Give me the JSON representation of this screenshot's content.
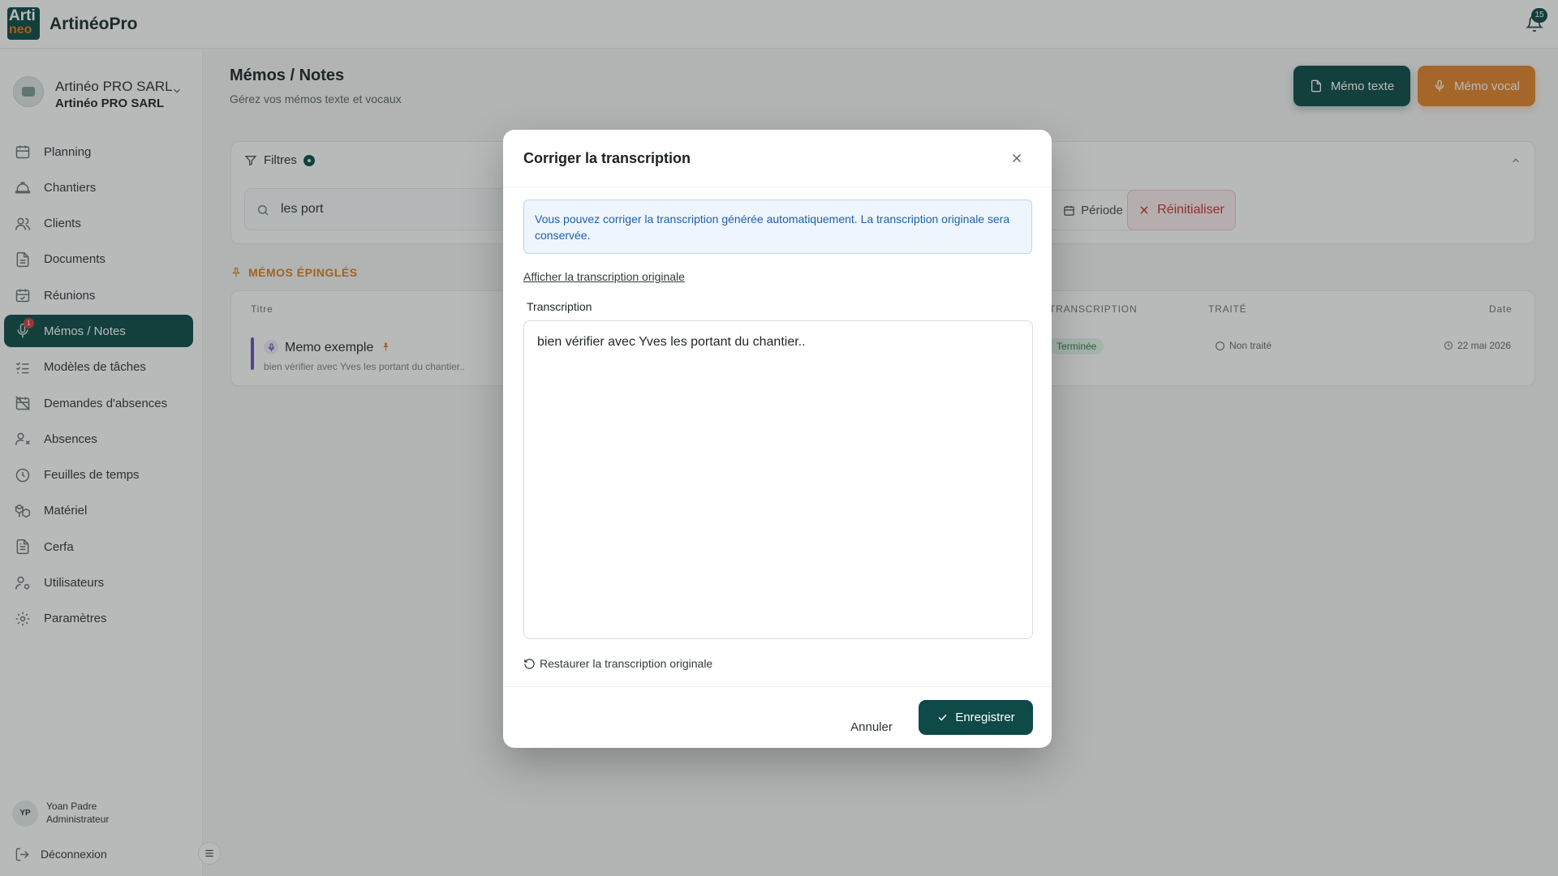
{
  "app": {
    "name": "ArtinéoPro",
    "logo_line1": "Arti",
    "logo_line2": "neo",
    "notification_count": "15"
  },
  "company": {
    "name": "Artinéo PRO SARL",
    "subname": "Artinéo PRO SARL"
  },
  "nav": [
    {
      "label": "Planning",
      "icon": "calendar-icon"
    },
    {
      "label": "Chantiers",
      "icon": "hardhat-icon"
    },
    {
      "label": "Clients",
      "icon": "users-icon"
    },
    {
      "label": "Documents",
      "icon": "file-icon"
    },
    {
      "label": "Réunions",
      "icon": "calendar-check-icon"
    },
    {
      "label": "Mémos / Notes",
      "icon": "mic-icon",
      "active": true,
      "badge": "1"
    },
    {
      "label": "Modèles de tâches",
      "icon": "list-checks-icon"
    },
    {
      "label": "Demandes d'absences",
      "icon": "calendar-off-icon"
    },
    {
      "label": "Absences",
      "icon": "user-x-icon"
    },
    {
      "label": "Feuilles de temps",
      "icon": "clock-icon"
    },
    {
      "label": "Matériel",
      "icon": "boxes-icon"
    },
    {
      "label": "Cerfa",
      "icon": "file-text-icon"
    },
    {
      "label": "Utilisateurs",
      "icon": "user-cog-icon"
    },
    {
      "label": "Paramètres",
      "icon": "gear-icon"
    }
  ],
  "user": {
    "initials": "YP",
    "name": "Yoan Padre",
    "role": "Administrateur"
  },
  "logout_label": "Déconnexion",
  "page": {
    "title": "Mémos / Notes",
    "subtitle": "Gérez vos mémos texte et vocaux"
  },
  "actions": {
    "text_memo": "Mémo texte",
    "voice_memo": "Mémo vocal"
  },
  "filters": {
    "label": "Filtres",
    "search_value": "les port",
    "period": "Période",
    "reset": "Réinitialiser"
  },
  "pinned": {
    "label": "MÉMOS ÉPINGLÉS"
  },
  "table": {
    "columns": {
      "title": "Titre",
      "transcription": "TRANSCRIPTION",
      "treated": "TRAITÉ",
      "date": "Date"
    },
    "row": {
      "title": "Memo exemple",
      "preview": "bien vérifier avec Yves les portant du chantier..",
      "status": "Terminée",
      "treated": "Non traité",
      "date": "22 mai 2026"
    }
  },
  "modal": {
    "title": "Corriger la transcription",
    "info": "Vous pouvez corriger la transcription générée automatiquement. La transcription originale sera conservée.",
    "show_original": "Afficher la transcription originale",
    "field_label": "Transcription",
    "transcription": "bien vérifier avec Yves les portant du chantier..",
    "restore": "Restaurer la transcription originale",
    "cancel": "Annuler",
    "save": "Enregistrer"
  }
}
